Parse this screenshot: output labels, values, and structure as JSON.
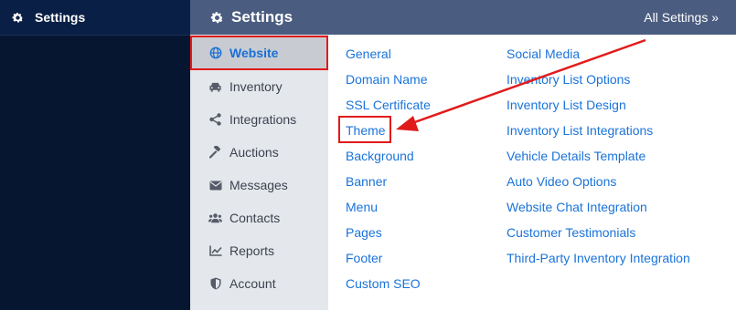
{
  "leftnav": {
    "title": "Settings",
    "icon": "gear-icon"
  },
  "header": {
    "title": "Settings",
    "icon": "gear-icon",
    "all_settings": "All Settings »"
  },
  "subnav": {
    "items": [
      {
        "label": "Website",
        "icon": "globe-icon",
        "active": true
      },
      {
        "label": "Inventory",
        "icon": "car-icon"
      },
      {
        "label": "Integrations",
        "icon": "share-icon"
      },
      {
        "label": "Auctions",
        "icon": "gavel-icon"
      },
      {
        "label": "Messages",
        "icon": "envelope-icon"
      },
      {
        "label": "Contacts",
        "icon": "users-icon"
      },
      {
        "label": "Reports",
        "icon": "chart-icon"
      },
      {
        "label": "Account",
        "icon": "shield-icon"
      }
    ]
  },
  "links": {
    "col1": [
      "General",
      "Domain Name",
      "SSL Certificate",
      "Theme",
      "Background",
      "Banner",
      "Menu",
      "Pages",
      "Footer",
      "Custom SEO"
    ],
    "col2": [
      "Social Media",
      "Inventory List Options",
      "Inventory List Design",
      "Inventory List Integrations",
      "Vehicle Details Template",
      "Auto Video Options",
      "Website Chat Integration",
      "Customer Testimonials",
      "Third-Party Inventory Integration"
    ]
  },
  "colors": {
    "link": "#1a73d9",
    "highlight": "#e11b1b",
    "header": "#4a5c80",
    "dark_nav": "#061530"
  }
}
